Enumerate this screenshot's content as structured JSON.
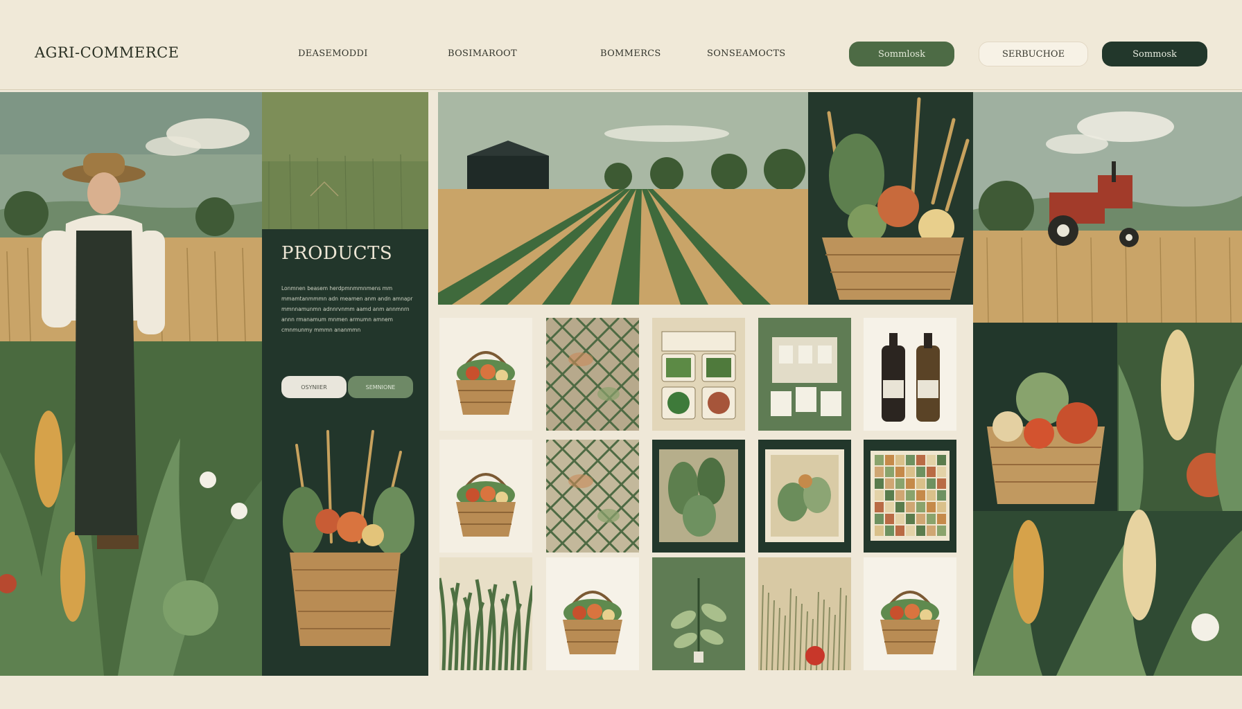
{
  "brand": {
    "logo": "AGRI-COMMERCE"
  },
  "nav": [
    {
      "label": "DEASEMODDI"
    },
    {
      "label": "BOSIMAROOT"
    },
    {
      "label": "BOMMERCS"
    },
    {
      "label": "SONSEAMOCTS"
    }
  ],
  "header_buttons": [
    {
      "label": "Sommlosk"
    },
    {
      "label": "SERBUCHOE"
    },
    {
      "label": "Sommosk"
    }
  ],
  "products_panel": {
    "title": "PRODUCTS",
    "description": "Lonmnen beasem herdpmnmmnmens mm mmamtanmmmn adn meamen anm andn amnapr mmnnamunmn adnnrvnmm aamd anm annmnrn annn rmanamum mnmen armumn amnem cmnmunmy mmmn ananmmn",
    "button_primary": "OSYNIIER",
    "button_secondary": "SEMNIONE"
  },
  "tiles": [
    {
      "name": "basket-tile-1",
      "kind": "basket",
      "bg": "#f4efe3"
    },
    {
      "name": "lattice-tile-1",
      "kind": "lattice",
      "bg": "#b7a98c"
    },
    {
      "name": "seed-packets-tile",
      "kind": "packets",
      "bg": "#e2d6b9"
    },
    {
      "name": "seed-cards-tile",
      "kind": "cards",
      "bg": "#5f7c54"
    },
    {
      "name": "bottles-tile",
      "kind": "bottles",
      "bg": "#f6f2e8"
    },
    {
      "name": "basket-tile-2",
      "kind": "basket",
      "bg": "#f4efe3"
    },
    {
      "name": "lattice-tile-2",
      "kind": "lattice",
      "bg": "#c3b89b"
    },
    {
      "name": "leaf-frame-tile-1",
      "kind": "leafframe",
      "bg": "#22372b"
    },
    {
      "name": "leaf-frame-tile-2",
      "kind": "leafframe2",
      "bg": "#22372b"
    },
    {
      "name": "color-grid-tile",
      "kind": "grid",
      "bg": "#22372b"
    },
    {
      "name": "grass-tile",
      "kind": "grass",
      "bg": "#e8dfc7"
    },
    {
      "name": "basket-tile-3",
      "kind": "basket",
      "bg": "#f6f2e8"
    },
    {
      "name": "plant-tile",
      "kind": "plant",
      "bg": "#5f7c54"
    },
    {
      "name": "meadow-tile",
      "kind": "meadow",
      "bg": "#d8c9a4"
    },
    {
      "name": "basket-tile-4",
      "kind": "basket",
      "bg": "#f6f2e8"
    }
  ],
  "colors": {
    "background": "#efe8d8",
    "dark_green": "#22372b",
    "mid_green": "#4d6b45",
    "sage": "#6e8966",
    "wheat": "#c9a468",
    "tractor_red": "#a23b2a"
  }
}
